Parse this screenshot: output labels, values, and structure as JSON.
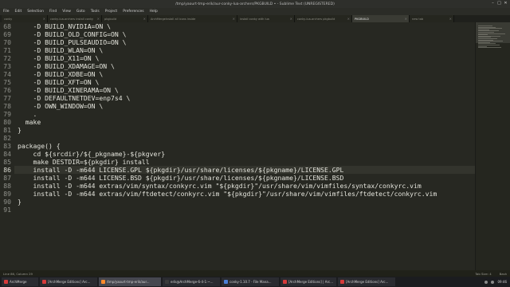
{
  "window": {
    "title": "/tmp/yaourt-tmp-erik/aur-conky-lua-archers/PKGBUILD • - Sublime Text (UNREGISTERED)",
    "controls": [
      "–",
      "□",
      "✕"
    ]
  },
  "menu": [
    "File",
    "Edit",
    "Selection",
    "Find",
    "View",
    "Goto",
    "Tools",
    "Project",
    "Preferences",
    "Help"
  ],
  "tabs": [
    {
      "label": "conky",
      "active": false
    },
    {
      "label": "conky-lua-archers install conky",
      "active": false
    },
    {
      "label": "pkgbuild",
      "active": false
    },
    {
      "label": "ArchMergeInstall all icons inside",
      "active": false
    },
    {
      "label": "install conky with lua",
      "active": false
    },
    {
      "label": "conky-lua-archers pkgbuild",
      "active": false
    },
    {
      "label": "PKGBUILD",
      "active": true
    },
    {
      "label": "new tab",
      "active": false
    }
  ],
  "editor": {
    "current_line": 86,
    "lines": [
      {
        "n": "68",
        "text": "    -D BUILD_NVIDIA=ON \\"
      },
      {
        "n": "69",
        "text": "    -D BUILD_OLD_CONFIG=ON \\"
      },
      {
        "n": "70",
        "text": "    -D BUILD_PULSEAUDIO=ON \\"
      },
      {
        "n": "71",
        "text": "    -D BUILD_WLAN=ON \\"
      },
      {
        "n": "72",
        "text": "    -D BUILD_X11=ON \\"
      },
      {
        "n": "73",
        "text": "    -D BUILD_XDAMAGE=ON \\"
      },
      {
        "n": "74",
        "text": "    -D BUILD_XDBE=ON \\"
      },
      {
        "n": "75",
        "text": "    -D BUILD_XFT=ON \\"
      },
      {
        "n": "76",
        "text": "    -D BUILD_XINERAMA=ON \\"
      },
      {
        "n": "77",
        "text": "    -D DEFAULTNETDEV=enp7s4 \\"
      },
      {
        "n": "78",
        "text": "    -D OWN_WINDOW=ON \\"
      },
      {
        "n": "79",
        "text": "    ."
      },
      {
        "n": "80",
        "text": "  make"
      },
      {
        "n": "81",
        "text": "}"
      },
      {
        "n": "82",
        "text": ""
      },
      {
        "n": "83",
        "text": "package() {"
      },
      {
        "n": "84",
        "text": "    cd ${srcdir}/${_pkgname}-${pkgver}"
      },
      {
        "n": "85",
        "text": "    make DESTDIR=${pkgdir} install"
      },
      {
        "n": "86",
        "text": "    install -D -m644 LICENSE.GPL ${pkgdir}/usr/share/licenses/${pkgname}/LICENSE.GPL"
      },
      {
        "n": "87",
        "text": "    install -D -m644 LICENSE.BSD ${pkgdir}/usr/share/licenses/${pkgname}/LICENSE.BSD"
      },
      {
        "n": "88",
        "text": "    install -D -m644 extras/vim/syntax/conkyrc.vim \"${pkgdir}\"/usr/share/vim/vimfiles/syntax/conkyrc.vim"
      },
      {
        "n": "89",
        "text": "    install -D -m644 extras/vim/ftdetect/conkyrc.vim \"${pkgdir}\"/usr/share/vim/vimfiles/ftdetect/conkyrc.vim"
      },
      {
        "n": "90",
        "text": "}"
      },
      {
        "n": "91",
        "text": ""
      }
    ]
  },
  "status": {
    "left": "Line 86, Column 29",
    "tab_size": "Tab Size: 4",
    "syntax": "Bash"
  },
  "taskbar": {
    "items": [
      {
        "label": "ArchMerge",
        "icon_color": "#d63b3b",
        "active": false
      },
      {
        "label": "[ArchMerge Editions] Arc...",
        "icon_color": "#d63b3b",
        "active": false
      },
      {
        "label": "/tmp/yaourt-tmp-erik/aur...",
        "icon_color": "#ff8a2b",
        "active": true
      },
      {
        "label": "erik@ArchMerge-6-4-1:~...",
        "icon_color": "#3a3a3a",
        "active": false
      },
      {
        "label": "conky-1.10.7 - File Mana...",
        "icon_color": "#4a7fd6",
        "active": false
      },
      {
        "label": "[ArchMerge Editions] | Arc...",
        "icon_color": "#d63b3b",
        "active": false
      },
      {
        "label": "[ArchMerge Editions] Arc...",
        "icon_color": "#d63b3b",
        "active": false
      }
    ],
    "clock": "09:46"
  }
}
